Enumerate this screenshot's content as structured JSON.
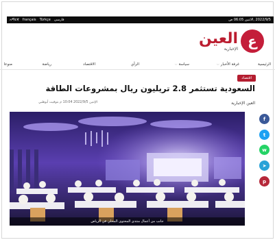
{
  "topbar": {
    "date": "2022/9/5 ,الاثنين 06:05 ص",
    "languages": [
      "فارسی",
      "Türkçe",
      "français",
      "አማርኛ"
    ]
  },
  "header": {
    "logo_main": "العين",
    "logo_sub": "الإخبارية",
    "logo_letter": "ع"
  },
  "nav": {
    "items": [
      {
        "label": "الرئيسية",
        "has_dropdown": false
      },
      {
        "label": "غرفة الأخبار",
        "has_dropdown": true
      },
      {
        "label": "سياسة",
        "has_dropdown": true
      },
      {
        "label": "الرأي",
        "has_dropdown": false
      },
      {
        "label": "الاقتصاد",
        "has_dropdown": false
      },
      {
        "label": "رياضة",
        "has_dropdown": false
      },
      {
        "label": "منوعا",
        "has_dropdown": false
      }
    ]
  },
  "article": {
    "category": "اقتصاد",
    "title": "السعودية تستثمر 2.8 تريليون ريال بمشروعات الطاقة",
    "author": "العين الإخبارية",
    "meta": "الإثنين 2022/9/5 10:04 م بتوقيت أبوظبي",
    "image_caption": "جانب من أعمال منتدى المحتوى المحلي في الرياض"
  },
  "share": [
    {
      "name": "facebook-icon",
      "glyph": "f",
      "color": "#3b5998"
    },
    {
      "name": "twitter-icon",
      "glyph": "t",
      "color": "#1da1f2"
    },
    {
      "name": "whatsapp-icon",
      "glyph": "w",
      "color": "#25d366"
    },
    {
      "name": "telegram-icon",
      "glyph": "➤",
      "color": "#2aa3d8"
    },
    {
      "name": "pinterest-icon",
      "glyph": "p",
      "color": "#b5283a"
    }
  ]
}
